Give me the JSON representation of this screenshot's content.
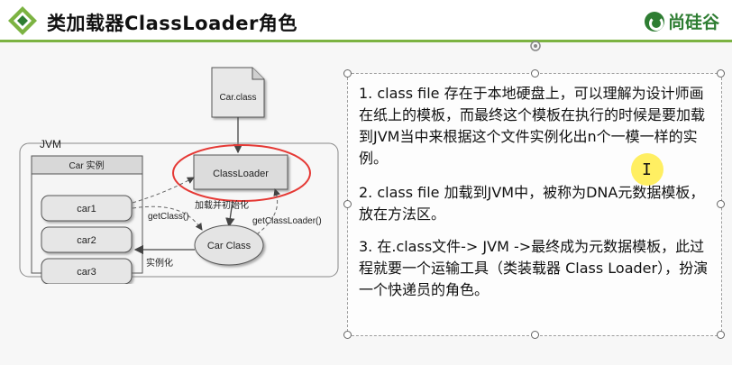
{
  "header": {
    "title": "类加载器ClassLoader角色",
    "brand": "尚硅谷",
    "accent": "#7cb342",
    "brand_color": "#2e7d32"
  },
  "diagram": {
    "file_label": "Car.class",
    "jvm_label": "JVM",
    "instance_header": "Car 实例",
    "instances": [
      "car1",
      "car2",
      "car3"
    ],
    "classloader_label": "ClassLoader",
    "load_label": "加载并初始化",
    "car_class_label": "Car Class",
    "get_class_label": "getClass()",
    "get_classloader_label": "getClassLoader()",
    "instantiate_label": "实例化",
    "highlight_color": "#e53935"
  },
  "text_panel": {
    "p1": "1. class file 存在于本地硬盘上，可以理解为设计师画在纸上的模板，而最终这个模板在执行的时候是要加载到JVM当中来根据这个文件实例化出n个一模一样的实例。",
    "p2": "2. class file 加载到JVM中，被称为DNA元数据模板，放在方法区。",
    "p3": "3. 在.class文件-> JVM ->最终成为元数据模板，此过程就要一个运输工具（类装载器 Class Loader），扮演一个快递员的角色。"
  },
  "icons": {
    "logo": "diamond-logo-icon",
    "rotate": "rotate-handle-icon",
    "cursor": "text-cursor-icon"
  }
}
